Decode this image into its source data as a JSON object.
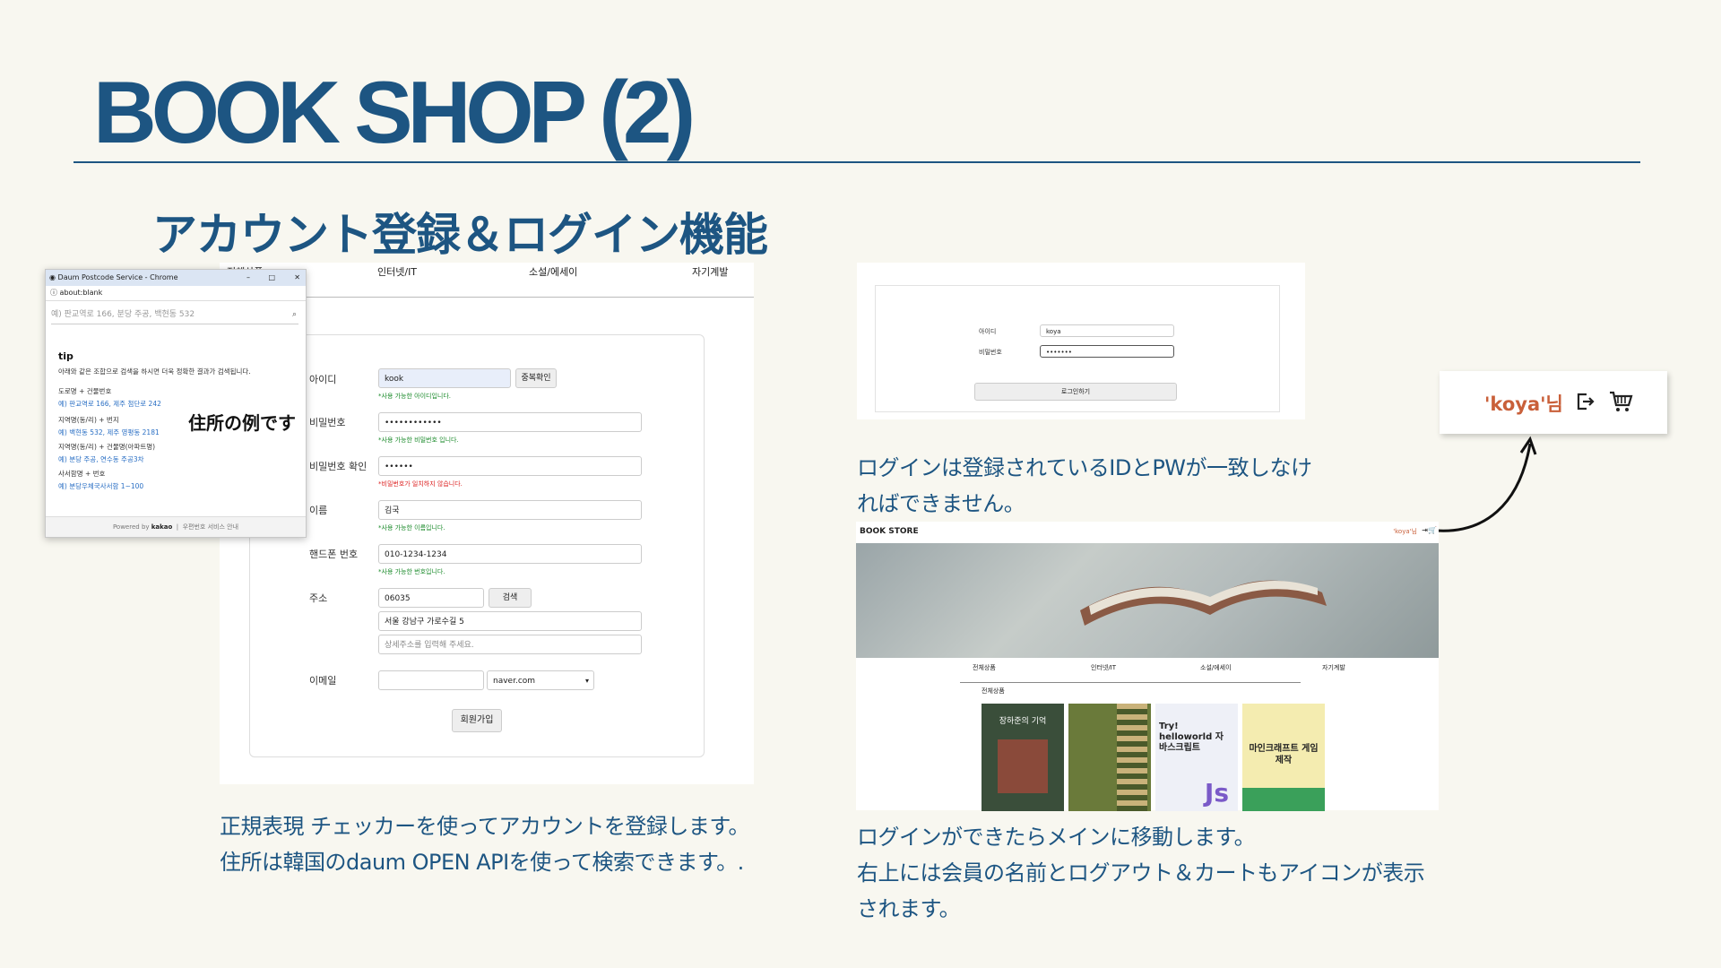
{
  "slide": {
    "title": "BOOK SHOP (2)",
    "subtitle": "アカウント登録＆ログイン機能",
    "caption_left": [
      "正規表現 チェッカーを使ってアカウントを登録します。",
      "住所は韓国のdaum OPEN APIを使って検索できます。."
    ],
    "caption_login": [
      "ログインは登録されているIDとPWが一致しなけ",
      "ればできません。"
    ],
    "caption_main": [
      "ログインができたらメインに移動します。",
      "右上には会員の名前とログアウト＆カートもアイコンが表示",
      "されます。"
    ],
    "address_note": "住所の例です"
  },
  "signup": {
    "nav": [
      "전체상품",
      "인터넷/IT",
      "소설/에세이",
      "자기계발"
    ],
    "fields": {
      "id_label": "아이디",
      "id_value": "kook",
      "id_check": "중복확인",
      "id_hint": "*사용 가능한 아이디입니다.",
      "pw_label": "비밀번호",
      "pw_value": "••••••••••••",
      "pw_hint": "*사용 가능한 비밀번호 입니다.",
      "pw2_label": "비밀번호 확인",
      "pw2_value": "••••••",
      "pw2_hint": "*비밀번호가 일치하지 않습니다.",
      "name_label": "이름",
      "name_value": "김국",
      "name_hint": "*사용 가능한 이름입니다.",
      "phone_label": "핸드폰 번호",
      "phone_value": "010-1234-1234",
      "phone_hint": "*사용 가능한 번호입니다.",
      "addr_label": "주소",
      "zip_value": "06035",
      "search_btn": "검색",
      "addr_value": "서울 강남구 가로수길 5",
      "addr_detail_placeholder": "상세주소를 입력해 주세요.",
      "email_label": "이메일",
      "email_domain": "naver.com",
      "submit": "회원가입"
    }
  },
  "popup": {
    "window_title": "Daum Postcode Service - Chrome",
    "url": "about:blank",
    "search_placeholder": "예) 판교역로 166, 분당 주공, 백현동 532",
    "tip_title": "tip",
    "tip_desc": "아래와 같은 조합으로 검색을 하시면 더욱 정확한 결과가 검색됩니다.",
    "examples": [
      {
        "head": "도로명 + 건물번호",
        "ex": "예) 판교역로 166, 제주 첨단로 242"
      },
      {
        "head": "지역명(동/리) + 번지",
        "ex": "예) 백현동 532, 제주 영평동 2181"
      },
      {
        "head": "지역명(동/리) + 건물명(아파트명)",
        "ex": "예) 분당 주공, 연수동 주공3차"
      },
      {
        "head": "사서함명 + 번호",
        "ex": "예) 분당우체국사서함 1~100"
      }
    ],
    "footer_powered": "Powered by",
    "footer_brand": "kakao",
    "footer_link": "우편번호 서비스 안내"
  },
  "login": {
    "id_label": "아이디",
    "id_value": "koya",
    "pw_label": "비밀번호",
    "pw_value": "•••••••",
    "button": "로그인하기"
  },
  "koya_badge": {
    "name": "'koya'님",
    "icons": [
      "logout-icon",
      "cart-icon"
    ],
    "name_color": "#c9603a"
  },
  "mainpage": {
    "brand": "BOOK STORE",
    "user": "'koya'님",
    "menu": [
      "전체상품",
      "인터넷/IT",
      "소설/에세이",
      "자기계발"
    ],
    "section": "전체상품",
    "books": [
      {
        "title": "장하준의 기억",
        "color": "#3a4e3a"
      },
      {
        "title": "",
        "color": "#6a7a3a"
      },
      {
        "title": "Try! helloworld 자바스크립트",
        "color": "#eef0f7"
      },
      {
        "title": "마인크래프트 게임 제작",
        "color": "#f4ecb0"
      }
    ]
  },
  "colors": {
    "accent": "#1d5582",
    "background": "#f8f7f0"
  }
}
